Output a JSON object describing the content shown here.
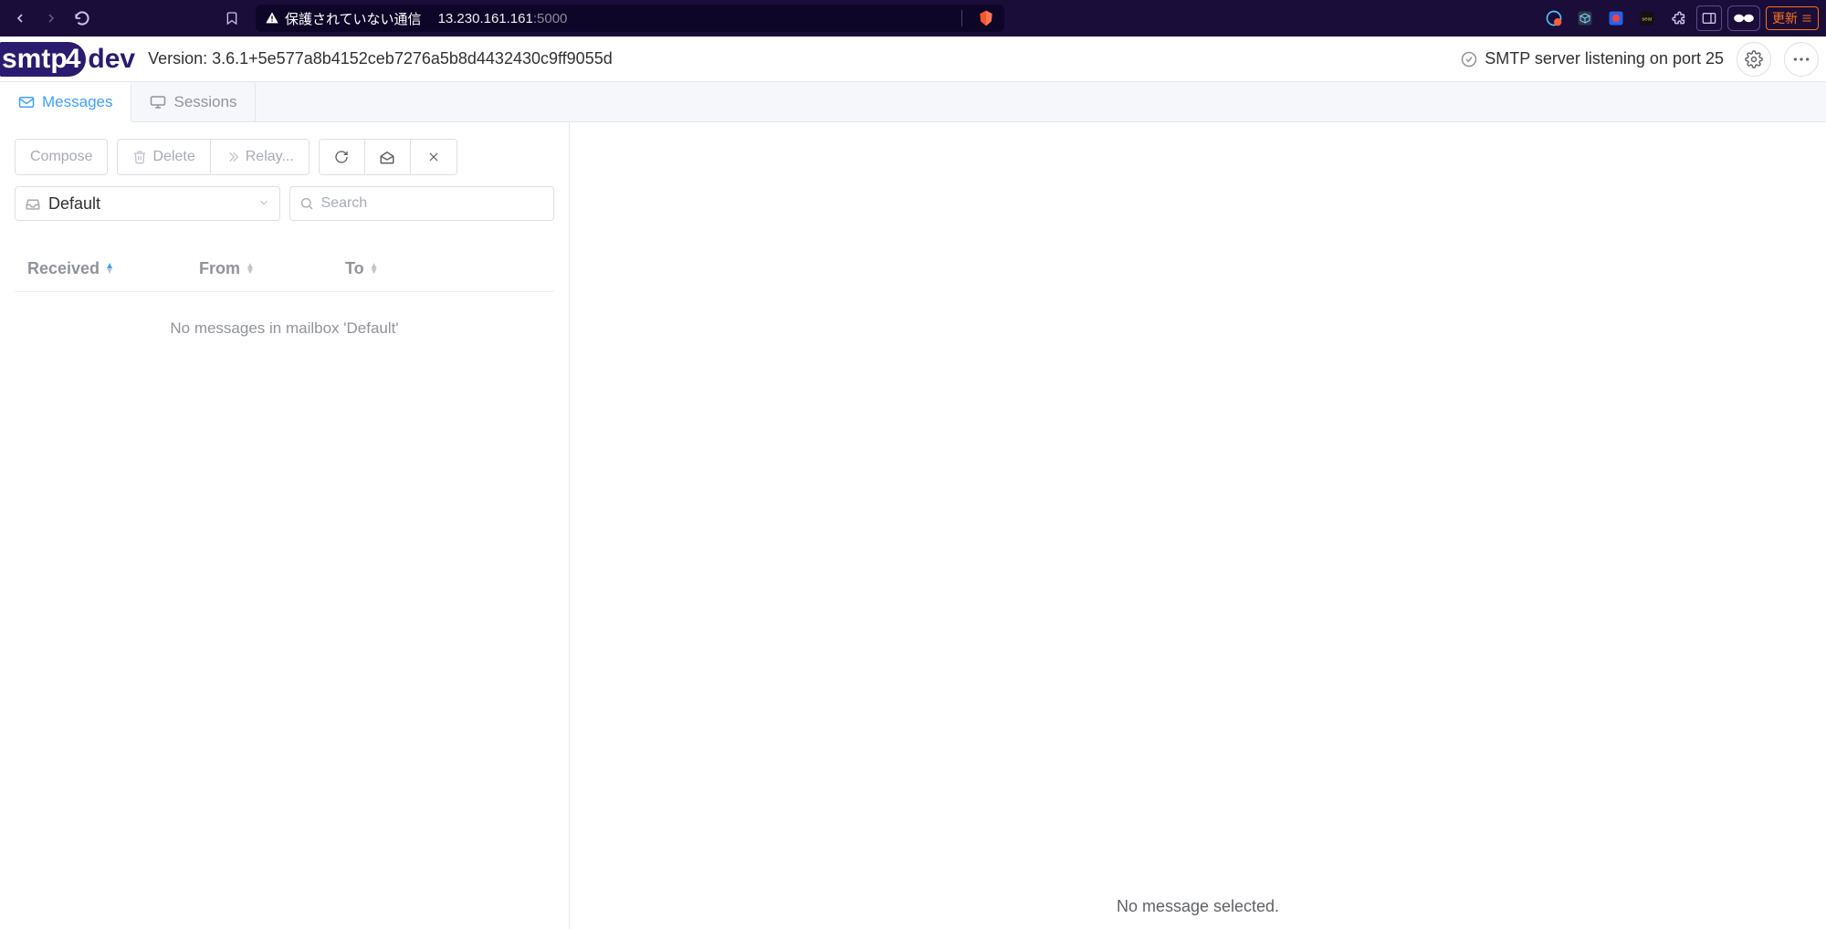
{
  "browser": {
    "security_label": "保護されていない通信",
    "host": "13.230.161.161",
    "port": ":5000",
    "update_label": "更新"
  },
  "header": {
    "version_label": "Version: 3.6.1+5e577a8b4152ceb7276a5b8d4432430c9ff9055d",
    "status_text": "SMTP server listening on port 25"
  },
  "tabs": {
    "messages": "Messages",
    "sessions": "Sessions"
  },
  "toolbar": {
    "compose": "Compose",
    "delete": "Delete",
    "relay": "Relay..."
  },
  "mailbox": {
    "selected": "Default",
    "search_placeholder": "Search"
  },
  "table": {
    "columns": {
      "received": "Received",
      "from": "From",
      "to": "To"
    },
    "empty_text": "No messages in mailbox 'Default'"
  },
  "detail": {
    "empty_text": "No message selected."
  }
}
